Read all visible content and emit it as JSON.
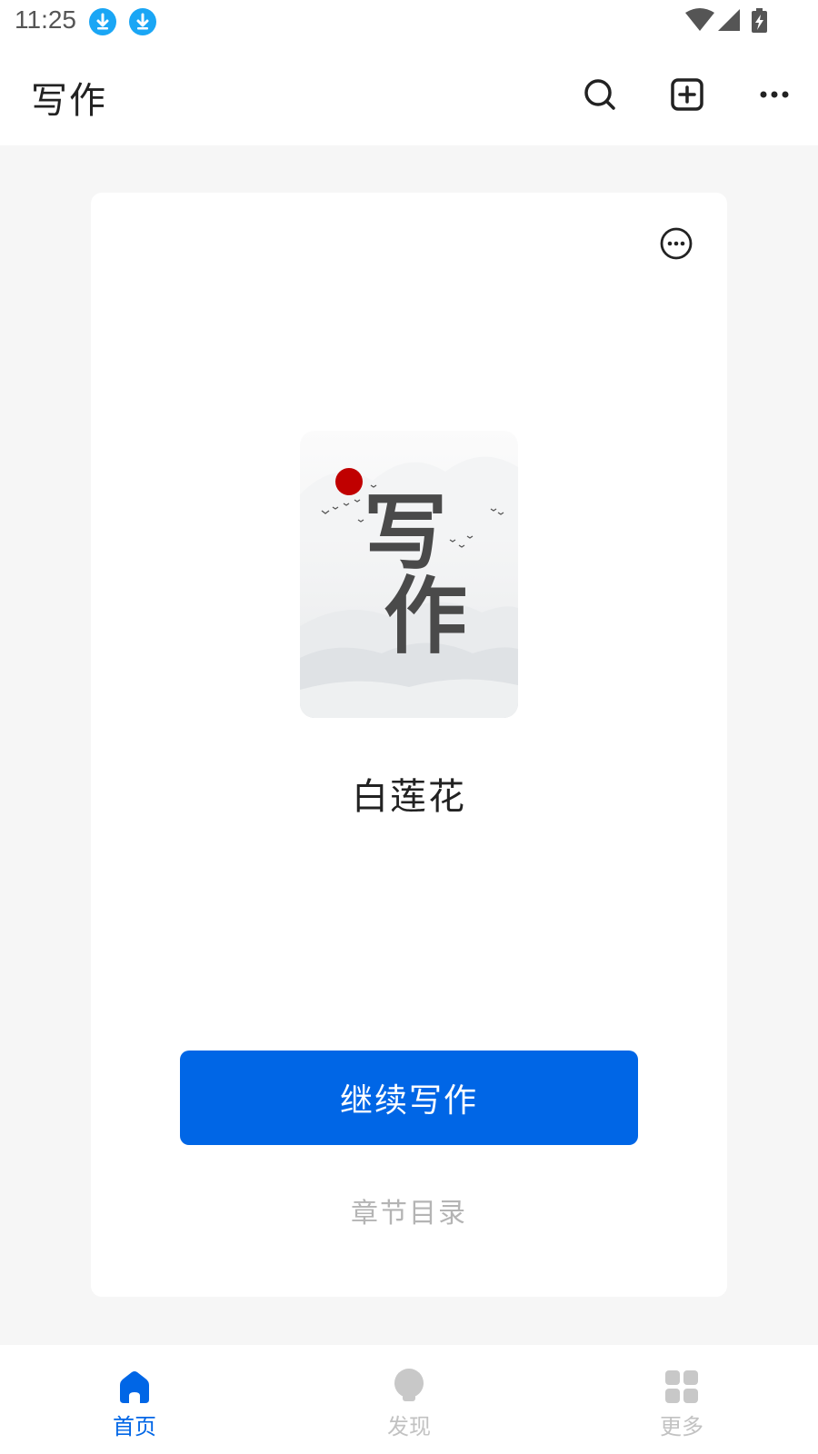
{
  "status_bar": {
    "time": "11:25",
    "icons": [
      "download-icon",
      "download-icon",
      "wifi-icon",
      "signal-icon",
      "battery-charging-icon"
    ]
  },
  "app_bar": {
    "title": "写作",
    "actions": [
      "search-icon",
      "add-square-icon",
      "more-horizontal-icon"
    ]
  },
  "book_card": {
    "cover_text": [
      "写",
      "作"
    ],
    "title": "白莲花",
    "continue_label": "继续写作",
    "toc_label": "章节目录"
  },
  "bottom_nav": {
    "items": [
      {
        "label": "首页",
        "icon": "home-icon",
        "active": true
      },
      {
        "label": "发现",
        "icon": "bulb-icon",
        "active": false
      },
      {
        "label": "更多",
        "icon": "grid-icon",
        "active": false
      }
    ]
  },
  "colors": {
    "accent": "#0066e6",
    "background": "#f6f6f6",
    "card": "#ffffff",
    "muted_text": "#b4b4b4",
    "download_badge": "#1aa6f5",
    "sun": "#c00000"
  }
}
